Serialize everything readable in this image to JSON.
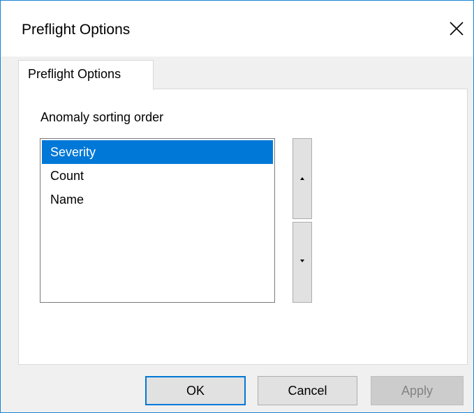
{
  "window": {
    "title": "Preflight Options",
    "close_icon": "close-icon"
  },
  "tabs": [
    {
      "label": "Preflight Options",
      "selected": true
    }
  ],
  "panel": {
    "group_label": "Anomaly sorting order",
    "list_items": [
      {
        "label": "Severity",
        "selected": true
      },
      {
        "label": "Count",
        "selected": false
      },
      {
        "label": "Name",
        "selected": false
      }
    ],
    "move_up_icon": "arrow-up-icon",
    "move_down_icon": "arrow-down-icon"
  },
  "buttons": {
    "ok": "OK",
    "cancel": "Cancel",
    "apply": "Apply"
  },
  "colors": {
    "selection": "#0078d7",
    "window_border": "#1883d7"
  }
}
